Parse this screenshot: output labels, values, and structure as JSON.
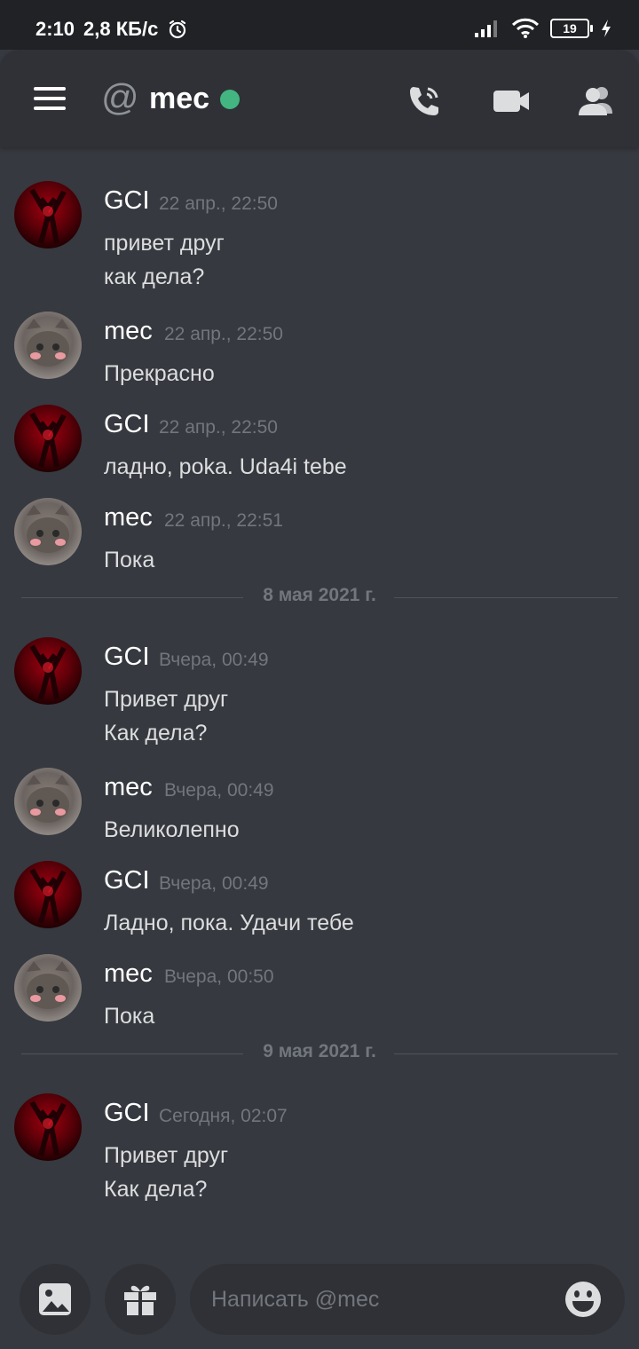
{
  "status_bar": {
    "time": "2:10",
    "speed": "2,8 КБ/с",
    "battery": "19"
  },
  "header": {
    "at_symbol": "@",
    "channel_name": "mec",
    "status_color": "#43b581",
    "icons": [
      "menu-icon",
      "call-icon",
      "video-icon",
      "members-icon"
    ]
  },
  "messages": [
    {
      "author": "GCI",
      "time": "22 апр., 22:50",
      "lines": [
        "привет друг",
        "как дела?"
      ]
    },
    {
      "author": "mec",
      "time": "22 апр., 22:50",
      "lines": [
        "Прекрасно"
      ]
    },
    {
      "author": "GCI",
      "time": "22 апр., 22:50",
      "lines": [
        "ладно, poka. Uda4i tebe"
      ]
    },
    {
      "author": "mec",
      "time": "22 апр., 22:51",
      "lines": [
        "Пока"
      ]
    },
    {
      "author": "GCI",
      "time": "Вчера, 00:49",
      "lines": [
        "Привет друг",
        "Как дела?"
      ]
    },
    {
      "author": "mec",
      "time": "Вчера, 00:49",
      "lines": [
        "Великолепно"
      ]
    },
    {
      "author": "GCI",
      "time": "Вчера, 00:49",
      "lines": [
        "Ладно, пока. Удачи тебе"
      ]
    },
    {
      "author": "mec",
      "time": "Вчера, 00:50",
      "lines": [
        "Пока"
      ]
    },
    {
      "author": "GCI",
      "time": "Сегодня, 02:07",
      "lines": [
        "Привет друг",
        "Как дела?"
      ]
    }
  ],
  "dividers": [
    "8 мая 2021 г.",
    "9 мая 2021 г."
  ],
  "composer": {
    "placeholder": "Написать @mec",
    "icons": [
      "image-icon",
      "gift-icon",
      "emoji-icon"
    ]
  }
}
